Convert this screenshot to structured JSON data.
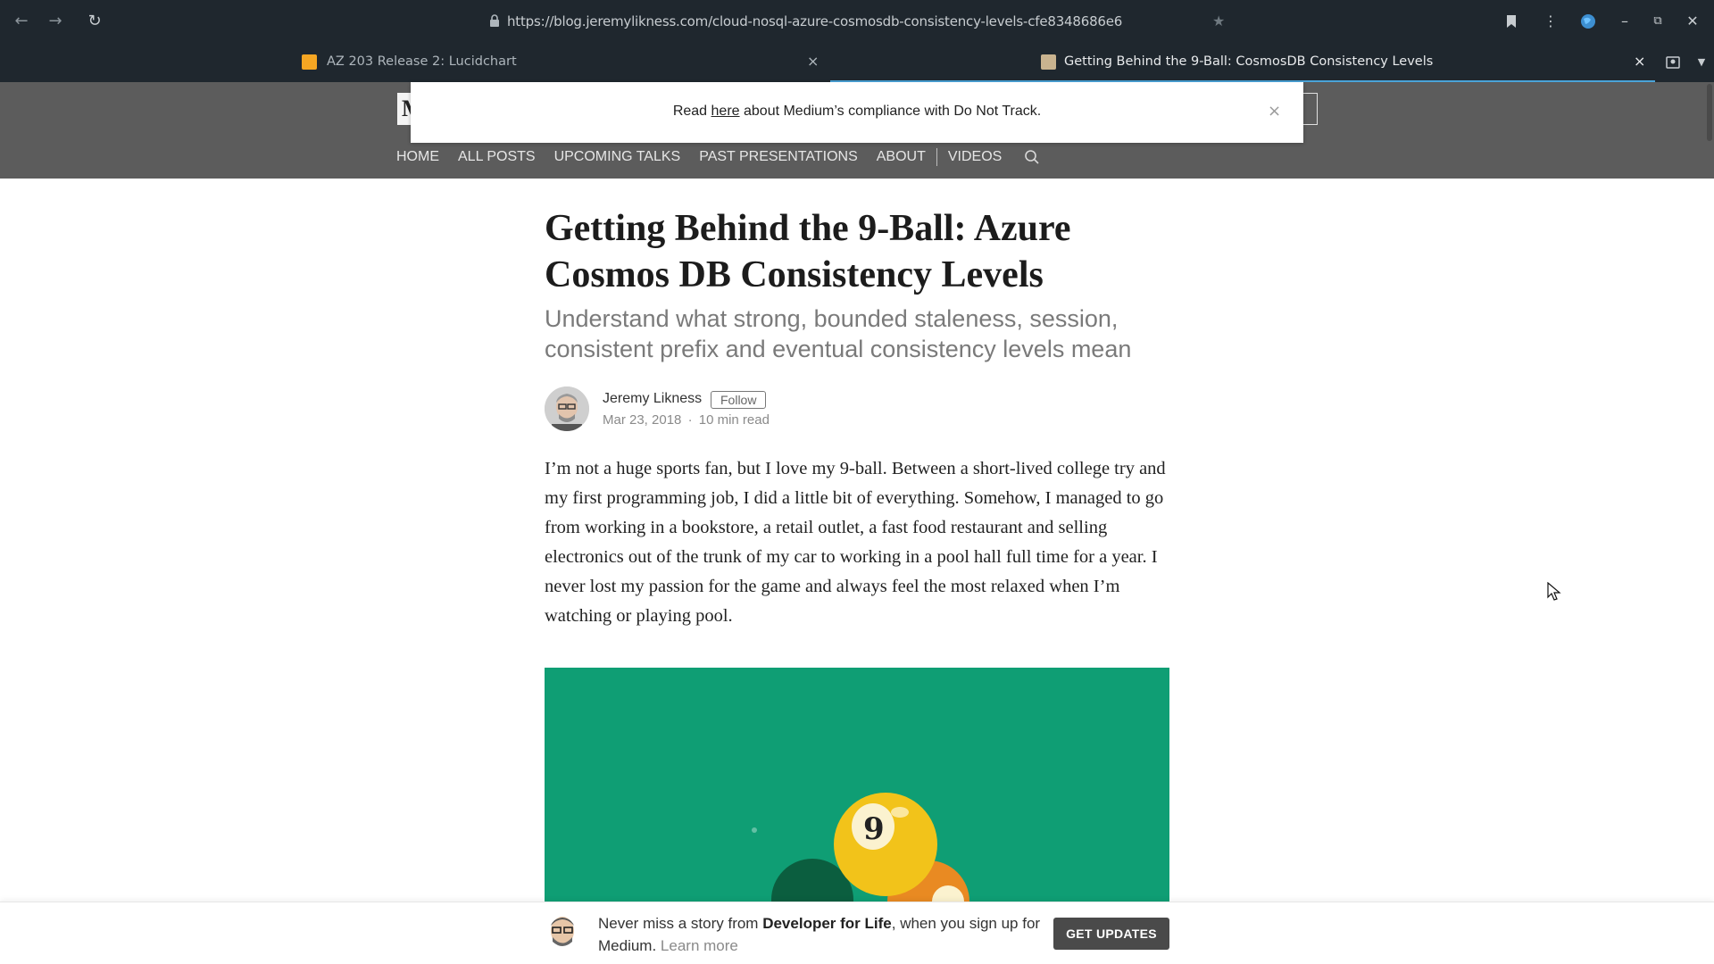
{
  "browser": {
    "url": "https://blog.jeremylikness.com/cloud-nosql-azure-cosmosdb-consistency-levels-cfe8348686e6",
    "tabs": [
      {
        "title": "AZ 203 Release 2: Lucidchart",
        "favicon_color": "#f5a623",
        "active": false
      },
      {
        "title": "Getting Behind the 9-Ball: CosmosDB Consistency Levels",
        "favicon_color": "#c9b38f",
        "active": true
      }
    ]
  },
  "site": {
    "logo_letter": "M",
    "nav": [
      "HOME",
      "ALL POSTS",
      "UPCOMING TALKS",
      "PAST PRESENTATIONS",
      "ABOUT",
      "VIDEOS"
    ]
  },
  "notice": {
    "prefix": "Read ",
    "link": "here",
    "suffix": " about Medium’s compliance with Do Not Track."
  },
  "post": {
    "title": "Getting Behind the 9-Ball: Azure Cosmos DB Consistency Levels",
    "subtitle": "Understand what strong, bounded staleness, session, consistent prefix and eventual consistency levels mean",
    "author": "Jeremy Likness",
    "follow_label": "Follow",
    "date": "Mar 23, 2018",
    "separator": "·",
    "read_time": "10 min read",
    "body": "I’m not a huge sports fan, but I love my 9-ball. Between a short-lived college try and my first programming job, I did a little bit of everything. Somehow, I managed to go from working in a bookstore, a retail outlet, a fast food restaurant and selling electronics out of the trunk of my car to working in a pool hall full time for a year. I never lost my passion for the game and always feel the most relaxed when I’m watching or playing pool."
  },
  "bottom_bar": {
    "prefix": "Never miss a story from ",
    "publication": "Developer for Life",
    "suffix": ", when you sign up for Medium. ",
    "learn_more": "Learn more",
    "button": "GET UPDATES"
  },
  "colors": {
    "chrome_bg": "#1f272e",
    "header_bg": "#5c5c5c",
    "felt_green": "#0f9e74",
    "active_tab_accent": "#4aa3d8"
  }
}
